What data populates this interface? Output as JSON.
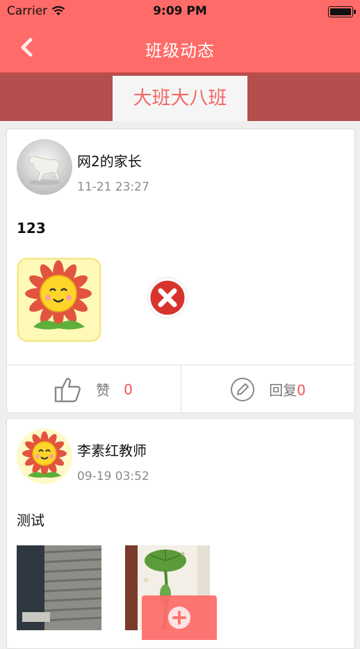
{
  "status_bar": {
    "carrier": "Carrier",
    "time": "9:09 PM"
  },
  "nav": {
    "title": "班级动态",
    "back_icon": "chevron-left-icon"
  },
  "tab": {
    "label": "大班大八班"
  },
  "posts": [
    {
      "author": "网2的家长",
      "time": "11-21 23:27",
      "text": "123",
      "like_label": "赞",
      "like_count": "0",
      "reply_label": "回复",
      "reply_count": "0"
    },
    {
      "author": "李素红教师",
      "time": "09-19 03:52",
      "text": "测试"
    }
  ],
  "colors": {
    "accent": "#fe6b68",
    "tab_band": "#b44f4d",
    "count": "#f05250"
  }
}
